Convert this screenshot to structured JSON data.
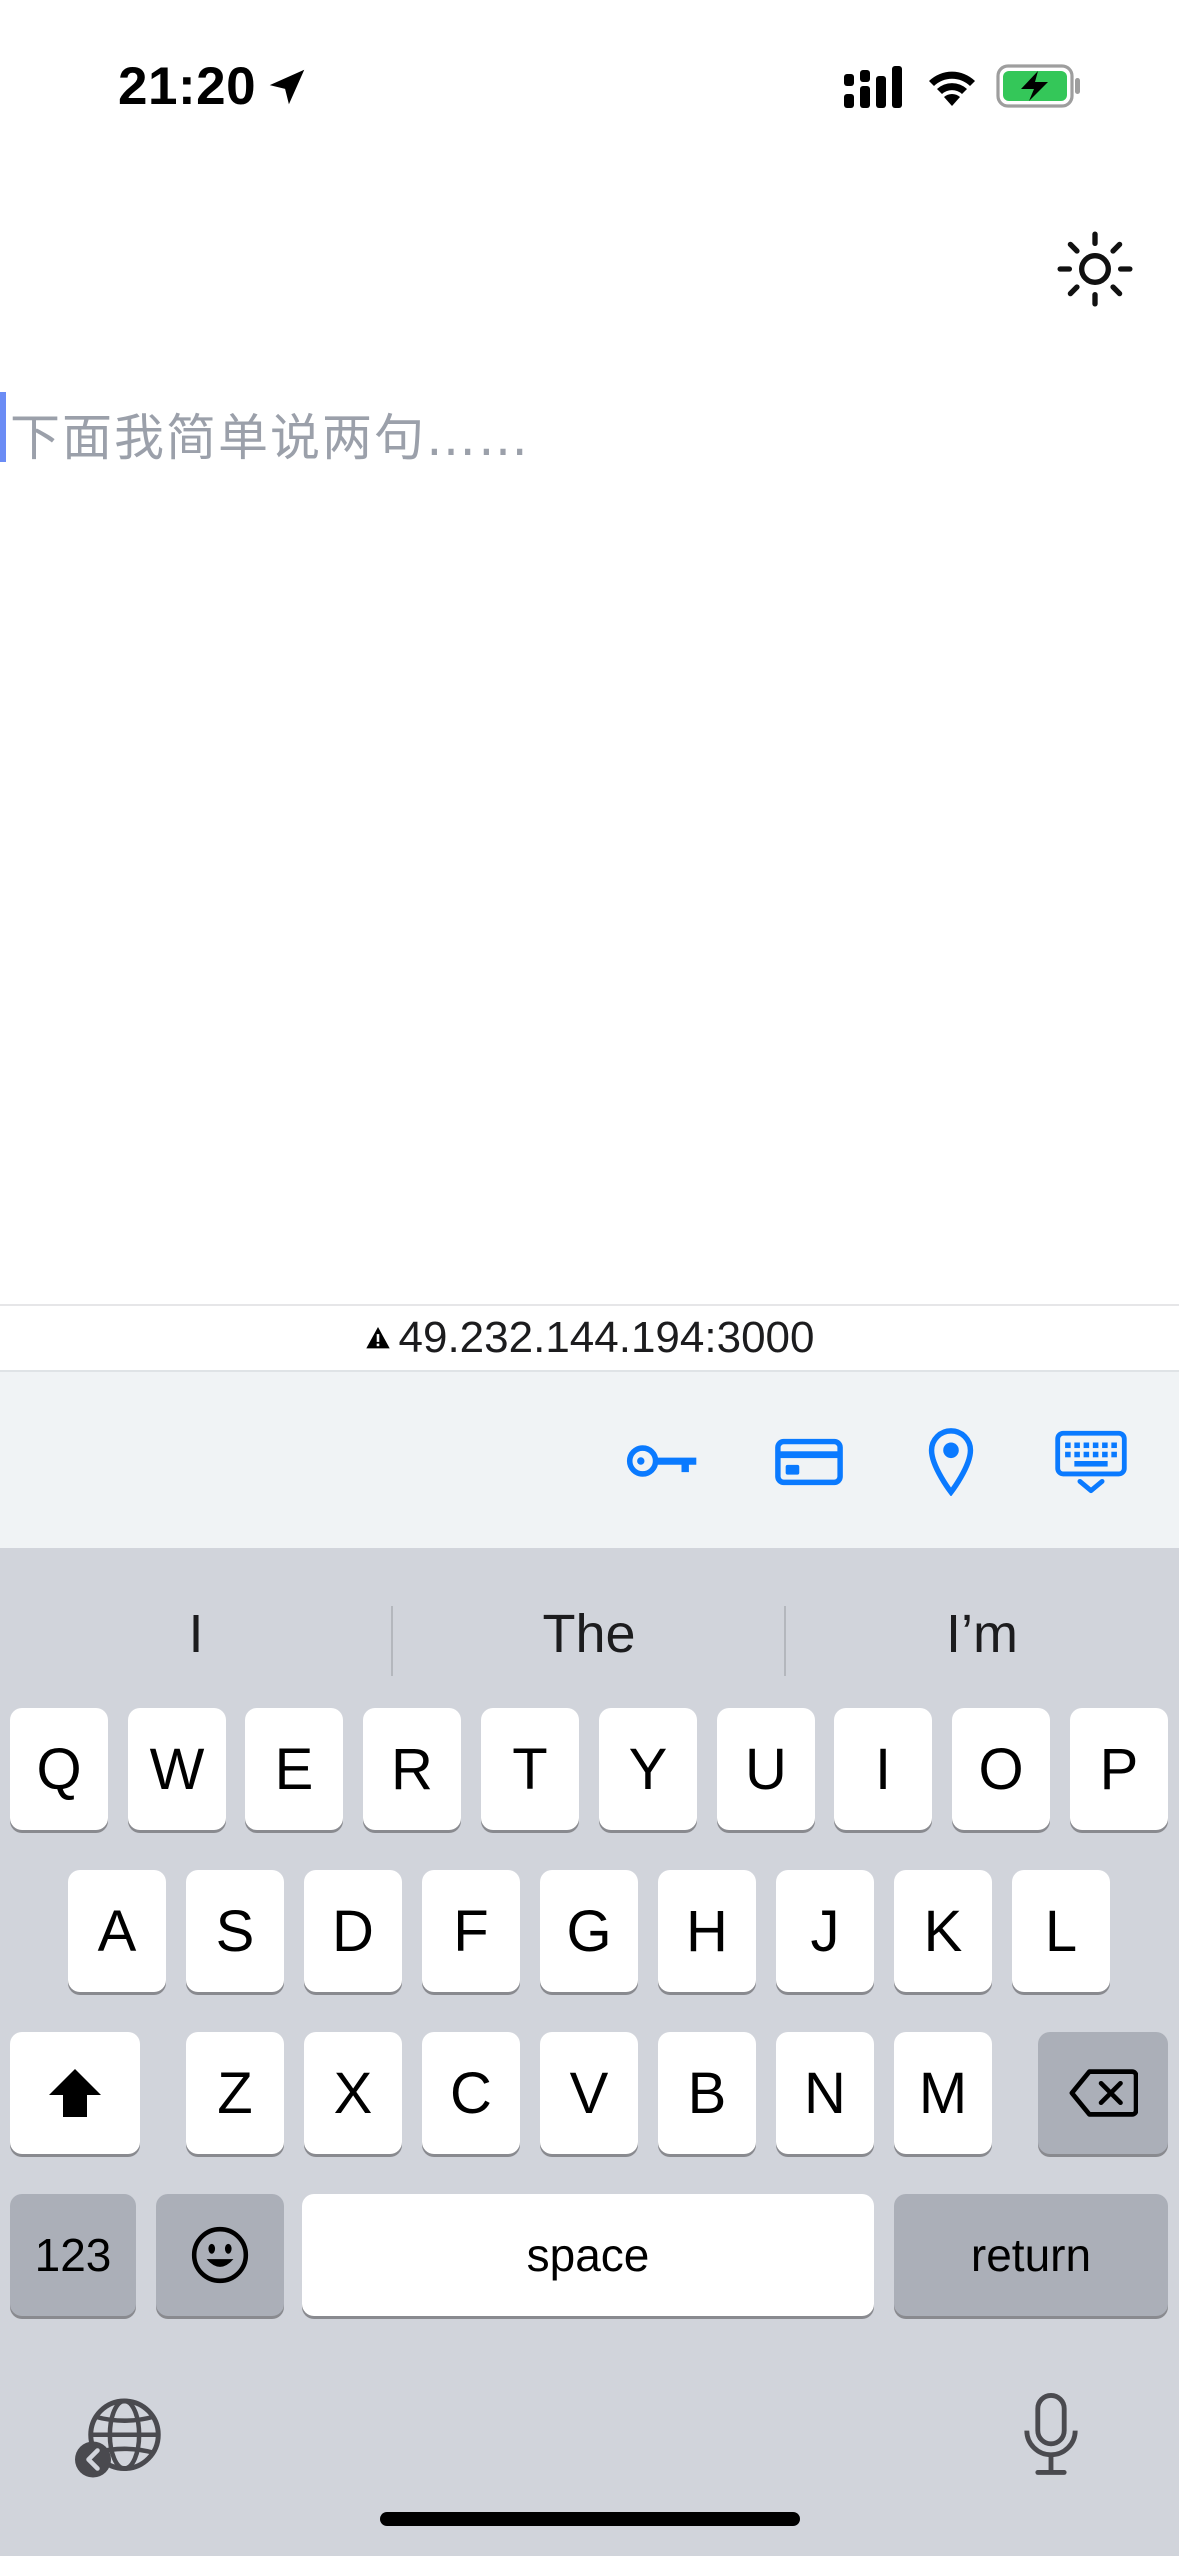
{
  "status_bar": {
    "time": "21:20",
    "battery_state": "charging",
    "battery_color": "#34c759"
  },
  "theme_toggle": {
    "icon": "sun-icon"
  },
  "editor": {
    "placeholder": "下面我简单说两句……",
    "caret_color": "#6b8cf5"
  },
  "address_bar": {
    "url": "49.232.144.194:3000",
    "warning_icon": "warning-triangle-icon"
  },
  "autofill_toolbar": {
    "accent_color": "#0a7aff",
    "icons": [
      "key-icon",
      "credit-card-icon",
      "location-pin-icon",
      "hide-keyboard-icon"
    ]
  },
  "keyboard": {
    "suggestions": [
      "I",
      "The",
      "I’m"
    ],
    "row1": [
      "Q",
      "W",
      "E",
      "R",
      "T",
      "Y",
      "U",
      "I",
      "O",
      "P"
    ],
    "row2": [
      "A",
      "S",
      "D",
      "F",
      "G",
      "H",
      "J",
      "K",
      "L"
    ],
    "row3": [
      "Z",
      "X",
      "C",
      "V",
      "B",
      "N",
      "M"
    ],
    "numbers_label": "123",
    "space_label": "space",
    "return_label": "return"
  }
}
